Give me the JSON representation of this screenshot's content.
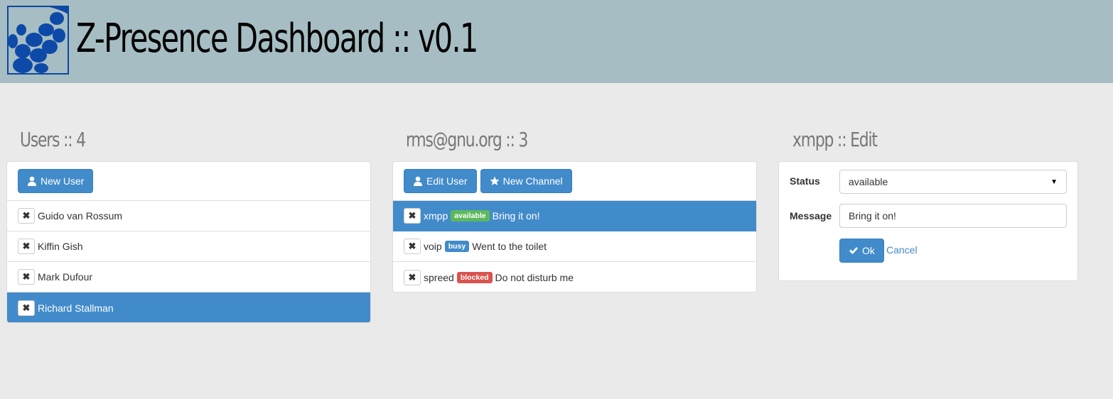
{
  "app": {
    "title": "Z-Presence Dashboard :: v0.1"
  },
  "users_panel": {
    "heading": "Users :: 4",
    "new_user_label": "New User",
    "users": [
      {
        "name": "Guido van Rossum",
        "active": false
      },
      {
        "name": "Kiffin Gish",
        "active": false
      },
      {
        "name": "Mark Dufour",
        "active": false
      },
      {
        "name": "Richard Stallman",
        "active": true
      }
    ]
  },
  "channels_panel": {
    "heading": "rms@gnu.org :: 3",
    "edit_user_label": "Edit User",
    "new_channel_label": "New Channel",
    "channels": [
      {
        "name": "xmpp",
        "status": "available",
        "message": "Bring it on!",
        "active": true,
        "color": "#5cb85c"
      },
      {
        "name": "voip",
        "status": "busy",
        "message": "Went to the toilet",
        "active": false,
        "color": "#428bca"
      },
      {
        "name": "spreed",
        "status": "blocked",
        "message": "Do not disturb me",
        "active": false,
        "color": "#d9534f"
      }
    ]
  },
  "edit_panel": {
    "heading": "xmpp :: Edit",
    "status_label": "Status",
    "status_value": "available",
    "message_label": "Message",
    "message_value": "Bring it on!",
    "ok_label": "Ok",
    "cancel_label": "Cancel"
  },
  "colors": {
    "header_bg": "#a6bec3",
    "accent": "#428bca",
    "page_bg": "#eaeaea"
  }
}
